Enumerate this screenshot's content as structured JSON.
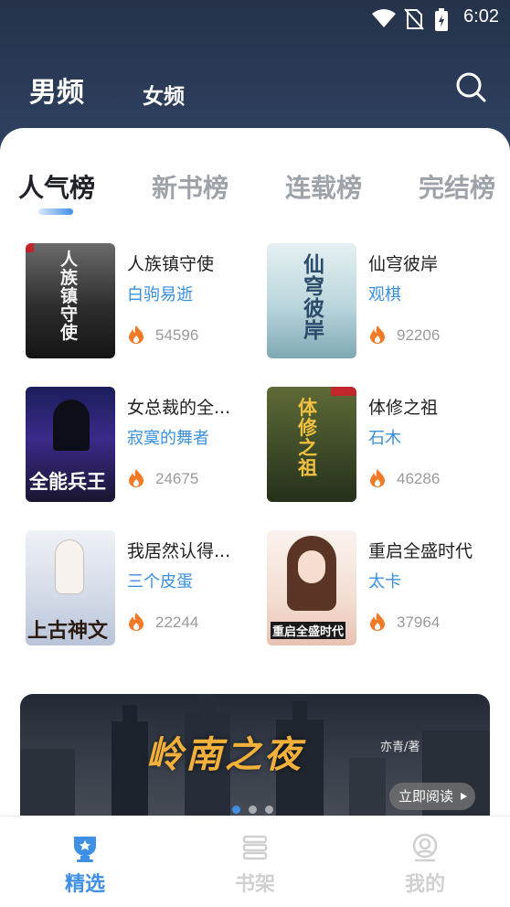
{
  "status_bar": {
    "time": "6:02"
  },
  "header": {
    "gender_tabs": [
      {
        "label": "男频",
        "active": true
      },
      {
        "label": "女频",
        "active": false
      }
    ],
    "search_icon": "search-icon"
  },
  "rank_tabs": [
    {
      "label": "人气榜",
      "active": true
    },
    {
      "label": "新书榜",
      "active": false
    },
    {
      "label": "连载榜",
      "active": false
    },
    {
      "label": "完结榜",
      "active": false
    }
  ],
  "books": [
    {
      "title": "人族镇守使",
      "author": "白驹易逝",
      "count": "54596",
      "cover_text": "人族镇守使"
    },
    {
      "title": "仙穹彼岸",
      "author": "观棋",
      "count": "92206",
      "cover_text": "仙穹彼岸"
    },
    {
      "title": "女总裁的全...",
      "author": "寂寞的舞者",
      "count": "24675",
      "cover_text": "全能兵王"
    },
    {
      "title": "体修之祖",
      "author": "石木",
      "count": "46286",
      "cover_text": "体修之祖"
    },
    {
      "title": "我居然认得...",
      "author": "三个皮蛋",
      "count": "22244",
      "cover_text": "上古神文"
    },
    {
      "title": "重启全盛时代",
      "author": "太卡",
      "count": "37964",
      "cover_text": "重启全盛时代"
    }
  ],
  "banner": {
    "title": "岭南之夜",
    "author": "亦青/著",
    "read_button": "立即阅读"
  },
  "bottom_nav": [
    {
      "label": "精选",
      "active": true,
      "icon": "trophy-icon"
    },
    {
      "label": "书架",
      "active": false,
      "icon": "bookshelf-icon"
    },
    {
      "label": "我的",
      "active": false,
      "icon": "profile-icon"
    }
  ],
  "colors": {
    "accent": "#3f8fe5",
    "header_bg": "#2b3a56",
    "author": "#3a8fdc",
    "fire": "#f07a28"
  }
}
